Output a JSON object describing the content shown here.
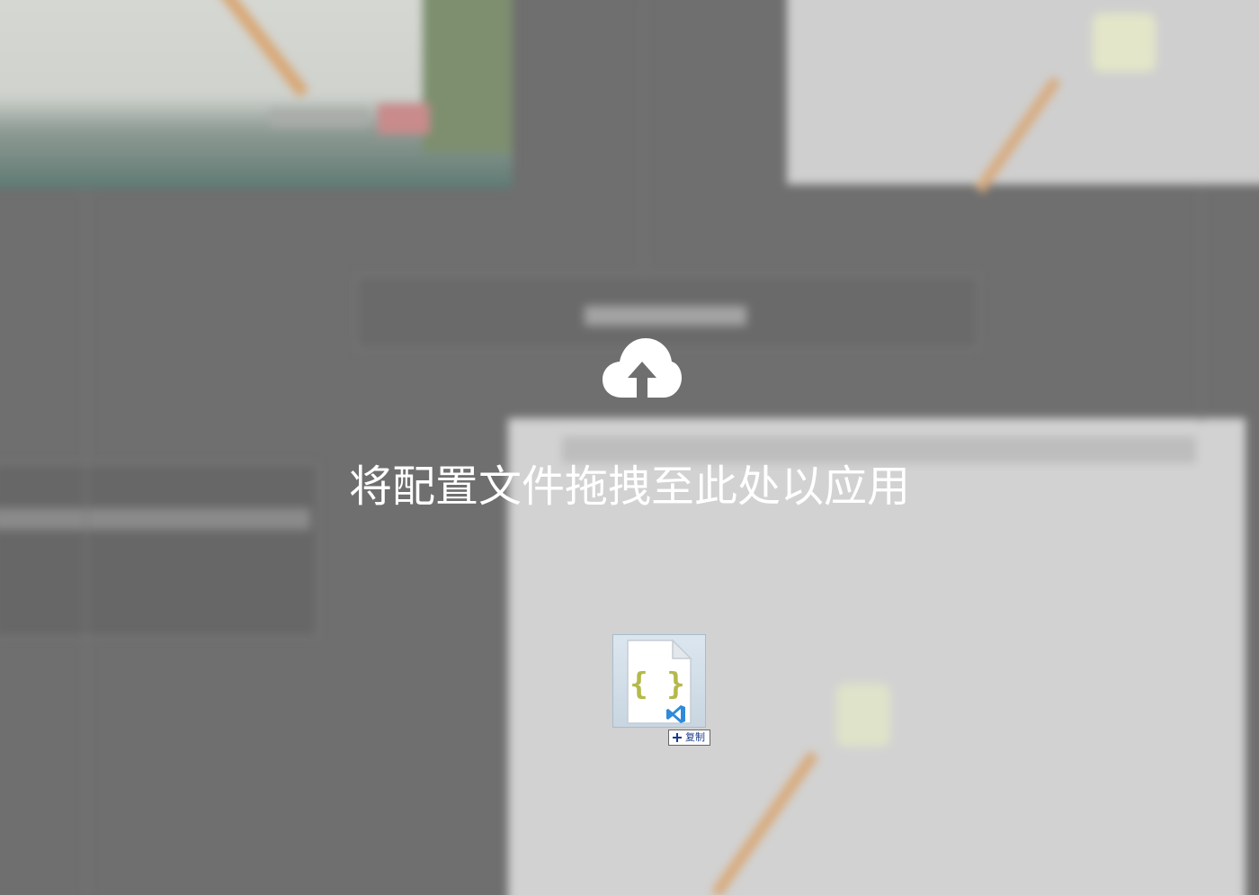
{
  "overlay": {
    "message": "将配置文件拖拽至此处以应用",
    "upload_icon": "cloud-upload-icon"
  },
  "drag": {
    "file_icon": "json-file-icon",
    "file_glyph": "{ }",
    "badge_icon": "plus-icon",
    "badge_label": "复制"
  },
  "colors": {
    "overlay": "#6f6f6f",
    "message_text": "#ffffff",
    "braces": "#b5b94a",
    "vscode_badge": "#2f8ad8",
    "copy_text": "#1a3a8c"
  }
}
